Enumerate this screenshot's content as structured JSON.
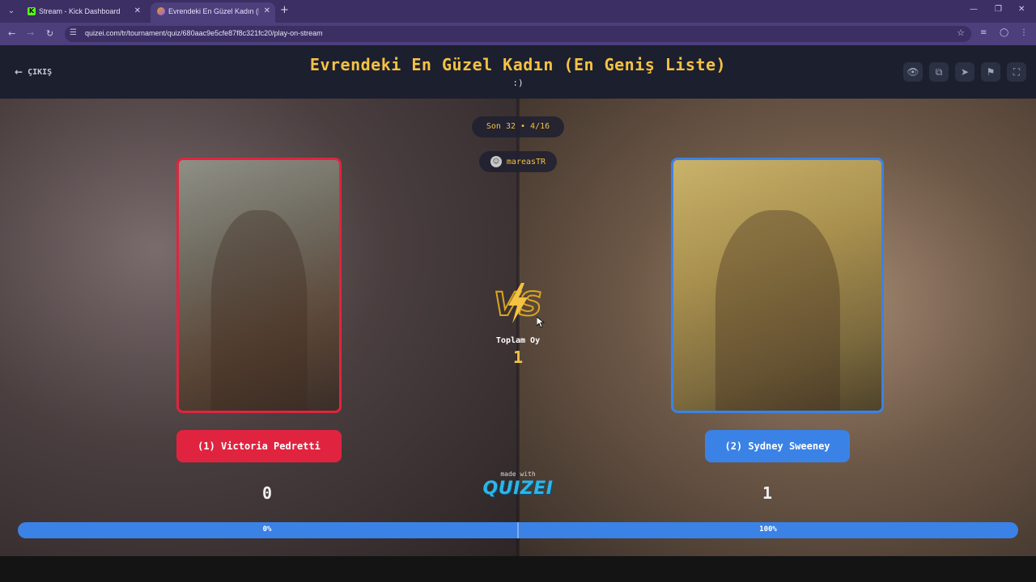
{
  "browser": {
    "tabs": [
      {
        "title": "Stream - Kick Dashboard",
        "favicon": "K",
        "active": false
      },
      {
        "title": "Evrendeki En Güzel Kadın (En G",
        "active": true
      }
    ],
    "url": "quizei.com/tr/tournament/quiz/680aac9e5cfe87f8c321fc20/play-on-stream"
  },
  "header": {
    "back_label": "ÇIKIŞ",
    "title": "Evrendeki En Güzel Kadın (En Geniş Liste)",
    "subtitle": ":)",
    "icons": [
      "eye-icon",
      "copy-icon",
      "send-icon",
      "flag-icon",
      "fullscreen-icon"
    ]
  },
  "round": {
    "label": "Son 32 • 4/16"
  },
  "streamer": {
    "username": "mareasTR"
  },
  "left": {
    "name": "(1) Victoria Pedretti",
    "score": "0",
    "percent": "0%",
    "color": "#e0243f"
  },
  "right": {
    "name": "(2) Sydney Sweeney",
    "score": "1",
    "percent": "100%",
    "color": "#3b82e6"
  },
  "vote_share": {
    "left_fraction": 0.0,
    "right_fraction": 1.0
  },
  "vs_text": "VS",
  "totals": {
    "label": "Toplam Oy",
    "value": "1"
  },
  "footer": {
    "made_with": "made with",
    "brand": "QUIZEI"
  },
  "colors": {
    "accent": "#f5c242",
    "header_bg": "#1c1f2e"
  }
}
